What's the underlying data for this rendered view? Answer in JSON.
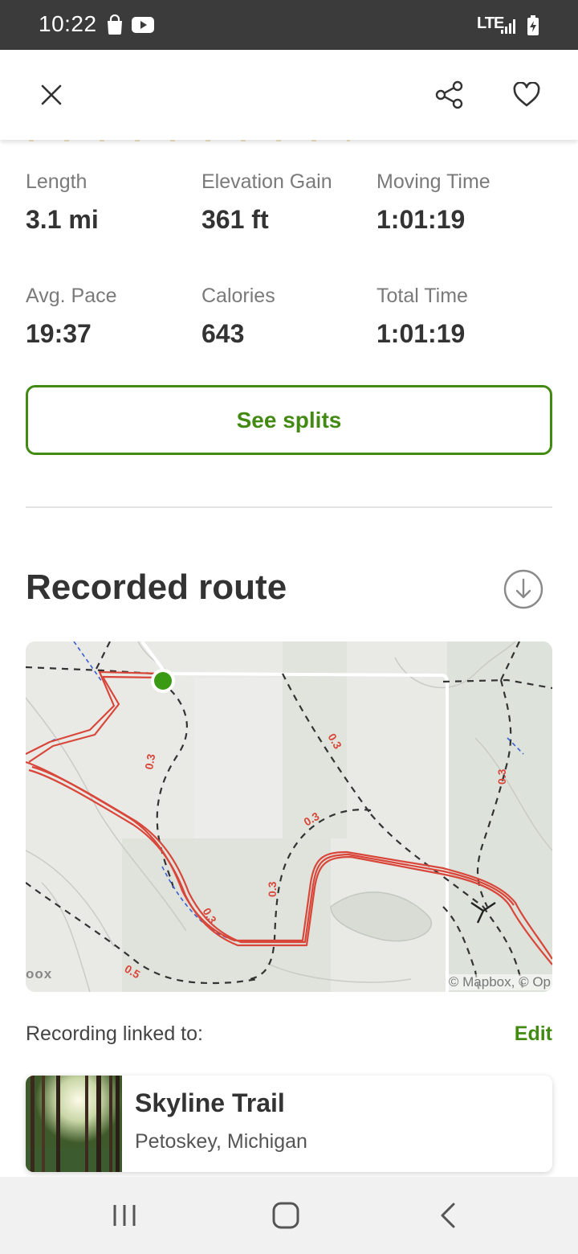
{
  "status_bar": {
    "time": "10:22",
    "network": "LTE",
    "icons": [
      "shopping-bag-icon",
      "youtube-icon",
      "signal-icon",
      "battery-charging-icon"
    ]
  },
  "header": {
    "close_icon": "close-icon",
    "share_icon": "share-icon",
    "favorite_icon": "heart-icon"
  },
  "stats": [
    {
      "label": "Length",
      "value": "3.1 mi"
    },
    {
      "label": "Elevation Gain",
      "value": "361 ft"
    },
    {
      "label": "Moving Time",
      "value": "1:01:19"
    },
    {
      "label": "Avg. Pace",
      "value": "19:37"
    },
    {
      "label": "Calories",
      "value": "643"
    },
    {
      "label": "Total Time",
      "value": "1:01:19"
    }
  ],
  "splits_button": "See splits",
  "route": {
    "title": "Recorded route",
    "download_icon": "download-icon",
    "map": {
      "attribution": "© Mapbox, © Op",
      "logo_fragment": "oox",
      "distance_labels": [
        "0.3",
        "0.3",
        "0.3",
        "0.3",
        "0.3",
        "0.3",
        "0.5"
      ]
    }
  },
  "linked": {
    "label": "Recording linked to:",
    "edit": "Edit",
    "trail_name": "Skyline Trail",
    "trail_location": "Petoskey, Michigan"
  },
  "colors": {
    "accent": "#428a13",
    "route_line": "#d9463a",
    "status_bar": "#3b3b3b"
  },
  "nav_bar": {
    "icons": [
      "recents-icon",
      "home-icon",
      "back-icon"
    ]
  }
}
